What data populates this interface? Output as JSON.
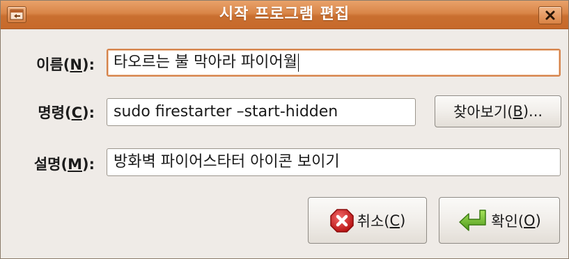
{
  "window": {
    "title": "시작 프로그램 편집"
  },
  "form": {
    "name": {
      "label_pre": "이름(",
      "mnemonic": "N",
      "label_post": "):",
      "value": "타오르는 불  막아라 파이어월"
    },
    "command": {
      "label_pre": "명령(",
      "mnemonic": "C",
      "label_post": "):",
      "value": "sudo firestarter –start-hidden",
      "browse_pre": "찾아보기(",
      "browse_mnemonic": "B",
      "browse_post": ")..."
    },
    "comment": {
      "label_pre": "설명(",
      "mnemonic": "M",
      "label_post": "):",
      "value": "방화벽 파이어스타터 아이콘 보이기"
    }
  },
  "buttons": {
    "cancel": {
      "pre": "취소(",
      "mnemonic": "C",
      "post": ")",
      "icon": "cancel-icon"
    },
    "ok": {
      "pre": "확인(",
      "mnemonic": "O",
      "post": ")",
      "icon": "enter-arrow-icon"
    }
  },
  "colors": {
    "titlebar": "#d98547",
    "focus_border": "#d5834b",
    "cancel_icon": "#d32222",
    "ok_icon": "#6bbf2a"
  }
}
